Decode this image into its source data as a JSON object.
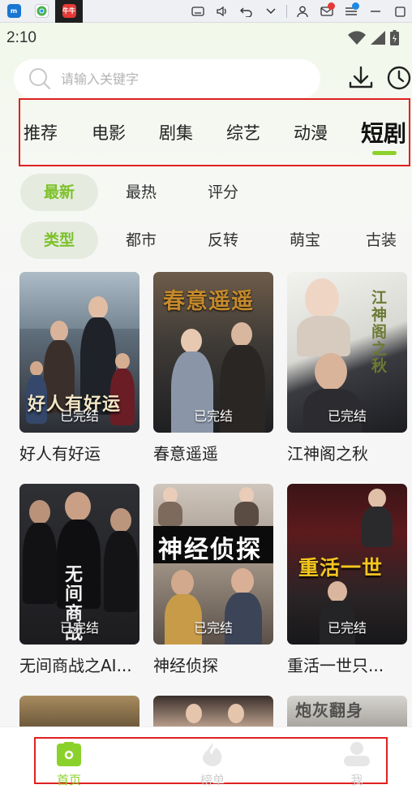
{
  "status_bar": {
    "time": "2:10"
  },
  "search": {
    "placeholder": "请输入关键字"
  },
  "channel_tabs": [
    {
      "label": "推荐"
    },
    {
      "label": "电影"
    },
    {
      "label": "剧集"
    },
    {
      "label": "综艺"
    },
    {
      "label": "动漫"
    },
    {
      "label": "短剧",
      "active": true
    }
  ],
  "sort_filters": [
    {
      "label": "最新",
      "selected": true
    },
    {
      "label": "最热"
    },
    {
      "label": "评分"
    }
  ],
  "type_filters": [
    {
      "label": "类型",
      "selected": true
    },
    {
      "label": "都市"
    },
    {
      "label": "反转"
    },
    {
      "label": "萌宝"
    },
    {
      "label": "古装"
    }
  ],
  "dramas": [
    {
      "title": "好人有好运",
      "status": "已完结",
      "poster_text": "好人有好运"
    },
    {
      "title": "春意遥遥",
      "status": "已完结",
      "poster_text": "春意遥遥"
    },
    {
      "title": "江神阁之秋",
      "status": "已完结",
      "poster_text": "江神阁之秋"
    },
    {
      "title": "无间商战之AI...",
      "status": "已完结",
      "poster_text": "无间商战"
    },
    {
      "title": "神经侦探",
      "status": "已完结",
      "poster_text": "神经侦探"
    },
    {
      "title": "重活一世只...",
      "status": "已完结",
      "poster_text": "重活一世"
    }
  ],
  "partial_posters": [
    {
      "poster_text": ""
    },
    {
      "poster_text": ""
    },
    {
      "poster_text": "炮灰翻身"
    }
  ],
  "bottom_nav": [
    {
      "label": "首页",
      "active": true
    },
    {
      "label": "榜单"
    },
    {
      "label": "我"
    }
  ],
  "taskbar": {
    "active_app_label": "牛牛"
  },
  "colors": {
    "accent": "#8bd12b",
    "highlight_box": "#e02020"
  }
}
